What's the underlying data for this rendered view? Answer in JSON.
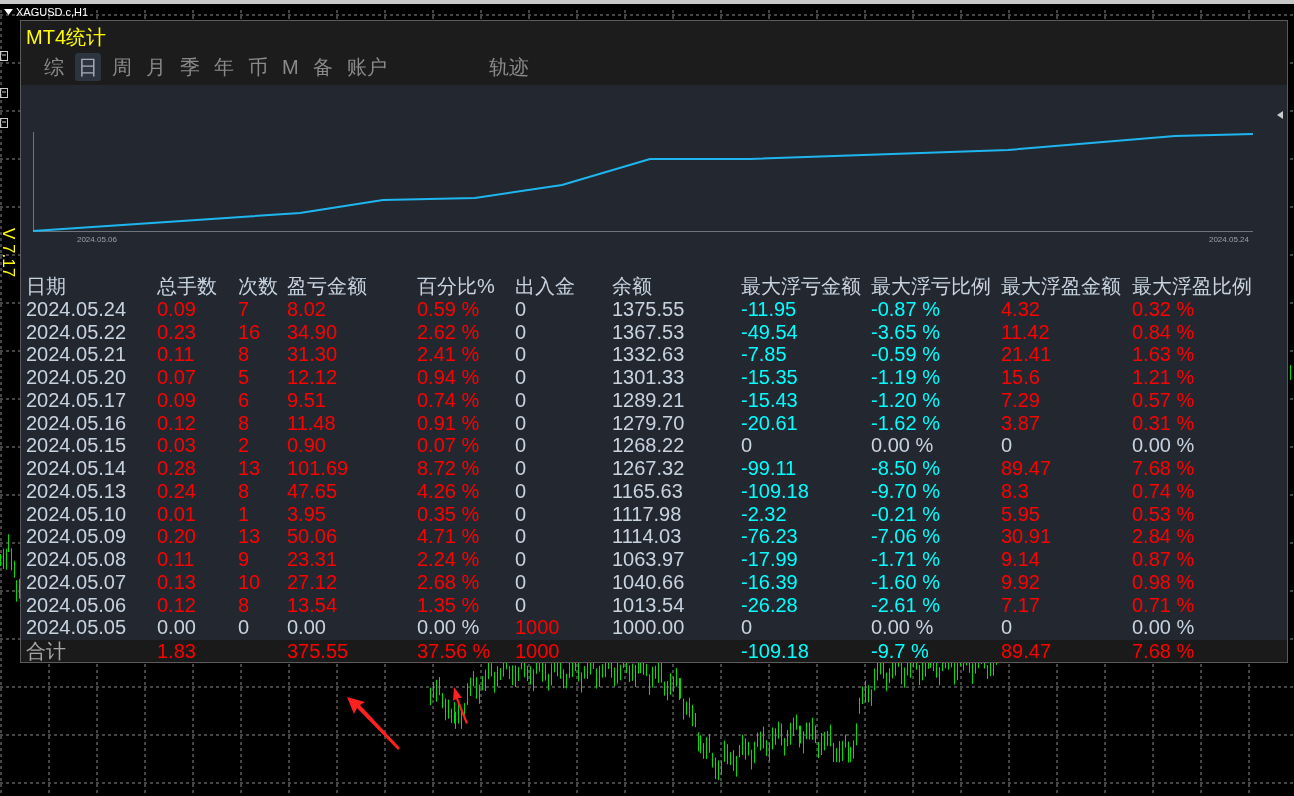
{
  "chart_window": {
    "symbol": "XAGUSD.c,H1",
    "version": "V 7.17"
  },
  "panel": {
    "title": "MT4统计",
    "tabs": [
      {
        "label": "综",
        "selected": false
      },
      {
        "label": "日",
        "selected": true
      },
      {
        "label": "周",
        "selected": false
      },
      {
        "label": "月",
        "selected": false
      },
      {
        "label": "季",
        "selected": false
      },
      {
        "label": "年",
        "selected": false
      },
      {
        "label": "币",
        "selected": false
      },
      {
        "label": "M",
        "selected": false
      },
      {
        "label": "备",
        "selected": false
      },
      {
        "label": "账户",
        "selected": false
      },
      {
        "label": "轨迹",
        "selected": false
      }
    ],
    "equity_chart": {
      "axis_labels": [
        "2024.05.06",
        "2024.05.24"
      ]
    },
    "table": {
      "columns": [
        "日期",
        "总手数",
        "次数",
        "盈亏金额",
        "百分比%",
        "出入金",
        "余额",
        "最大浮亏金额",
        "最大浮亏比例",
        "最大浮盈金额",
        "最大浮盈比例"
      ],
      "rows": [
        [
          {
            "text": "2024.05.24",
            "color": "#c8d3e0"
          },
          {
            "text": "0.09",
            "color": "#ff0000"
          },
          {
            "text": "7",
            "color": "#ff0000"
          },
          {
            "text": "8.02",
            "color": "#ff0000"
          },
          {
            "text": "0.59 %",
            "color": "#ff0000"
          },
          {
            "text": "0",
            "color": "#c8d3e0"
          },
          {
            "text": "1375.55",
            "color": "#c8d3e0"
          },
          {
            "text": "-11.95",
            "color": "#00ffff"
          },
          {
            "text": "-0.87 %",
            "color": "#00ffff"
          },
          {
            "text": "4.32",
            "color": "#ff0000"
          },
          {
            "text": "0.32 %",
            "color": "#ff0000"
          }
        ],
        [
          {
            "text": "2024.05.22",
            "color": "#c8d3e0"
          },
          {
            "text": "0.23",
            "color": "#ff0000"
          },
          {
            "text": "16",
            "color": "#ff0000"
          },
          {
            "text": "34.90",
            "color": "#ff0000"
          },
          {
            "text": "2.62 %",
            "color": "#ff0000"
          },
          {
            "text": "0",
            "color": "#c8d3e0"
          },
          {
            "text": "1367.53",
            "color": "#c8d3e0"
          },
          {
            "text": "-49.54",
            "color": "#00ffff"
          },
          {
            "text": "-3.65 %",
            "color": "#00ffff"
          },
          {
            "text": "11.42",
            "color": "#ff0000"
          },
          {
            "text": "0.84 %",
            "color": "#ff0000"
          }
        ],
        [
          {
            "text": "2024.05.21",
            "color": "#c8d3e0"
          },
          {
            "text": "0.11",
            "color": "#ff0000"
          },
          {
            "text": "8",
            "color": "#ff0000"
          },
          {
            "text": "31.30",
            "color": "#ff0000"
          },
          {
            "text": "2.41 %",
            "color": "#ff0000"
          },
          {
            "text": "0",
            "color": "#c8d3e0"
          },
          {
            "text": "1332.63",
            "color": "#c8d3e0"
          },
          {
            "text": "-7.85",
            "color": "#00ffff"
          },
          {
            "text": "-0.59 %",
            "color": "#00ffff"
          },
          {
            "text": "21.41",
            "color": "#ff0000"
          },
          {
            "text": "1.63 %",
            "color": "#ff0000"
          }
        ],
        [
          {
            "text": "2024.05.20",
            "color": "#c8d3e0"
          },
          {
            "text": "0.07",
            "color": "#ff0000"
          },
          {
            "text": "5",
            "color": "#ff0000"
          },
          {
            "text": "12.12",
            "color": "#ff0000"
          },
          {
            "text": "0.94 %",
            "color": "#ff0000"
          },
          {
            "text": "0",
            "color": "#c8d3e0"
          },
          {
            "text": "1301.33",
            "color": "#c8d3e0"
          },
          {
            "text": "-15.35",
            "color": "#00ffff"
          },
          {
            "text": "-1.19 %",
            "color": "#00ffff"
          },
          {
            "text": "15.6",
            "color": "#ff0000"
          },
          {
            "text": "1.21 %",
            "color": "#ff0000"
          }
        ],
        [
          {
            "text": "2024.05.17",
            "color": "#c8d3e0"
          },
          {
            "text": "0.09",
            "color": "#ff0000"
          },
          {
            "text": "6",
            "color": "#ff0000"
          },
          {
            "text": "9.51",
            "color": "#ff0000"
          },
          {
            "text": "0.74 %",
            "color": "#ff0000"
          },
          {
            "text": "0",
            "color": "#c8d3e0"
          },
          {
            "text": "1289.21",
            "color": "#c8d3e0"
          },
          {
            "text": "-15.43",
            "color": "#00ffff"
          },
          {
            "text": "-1.20 %",
            "color": "#00ffff"
          },
          {
            "text": "7.29",
            "color": "#ff0000"
          },
          {
            "text": "0.57 %",
            "color": "#ff0000"
          }
        ],
        [
          {
            "text": "2024.05.16",
            "color": "#c8d3e0"
          },
          {
            "text": "0.12",
            "color": "#ff0000"
          },
          {
            "text": "8",
            "color": "#ff0000"
          },
          {
            "text": "11.48",
            "color": "#ff0000"
          },
          {
            "text": "0.91 %",
            "color": "#ff0000"
          },
          {
            "text": "0",
            "color": "#c8d3e0"
          },
          {
            "text": "1279.70",
            "color": "#c8d3e0"
          },
          {
            "text": "-20.61",
            "color": "#00ffff"
          },
          {
            "text": "-1.62 %",
            "color": "#00ffff"
          },
          {
            "text": "3.87",
            "color": "#ff0000"
          },
          {
            "text": "0.31 %",
            "color": "#ff0000"
          }
        ],
        [
          {
            "text": "2024.05.15",
            "color": "#c8d3e0"
          },
          {
            "text": "0.03",
            "color": "#ff0000"
          },
          {
            "text": "2",
            "color": "#ff0000"
          },
          {
            "text": "0.90",
            "color": "#ff0000"
          },
          {
            "text": "0.07 %",
            "color": "#ff0000"
          },
          {
            "text": "0",
            "color": "#c8d3e0"
          },
          {
            "text": "1268.22",
            "color": "#c8d3e0"
          },
          {
            "text": "0",
            "color": "#c8d3e0"
          },
          {
            "text": "0.00 %",
            "color": "#c8d3e0"
          },
          {
            "text": "0",
            "color": "#c8d3e0"
          },
          {
            "text": "0.00 %",
            "color": "#c8d3e0"
          }
        ],
        [
          {
            "text": "2024.05.14",
            "color": "#c8d3e0"
          },
          {
            "text": "0.28",
            "color": "#ff0000"
          },
          {
            "text": "13",
            "color": "#ff0000"
          },
          {
            "text": "101.69",
            "color": "#ff0000"
          },
          {
            "text": "8.72 %",
            "color": "#ff0000"
          },
          {
            "text": "0",
            "color": "#c8d3e0"
          },
          {
            "text": "1267.32",
            "color": "#c8d3e0"
          },
          {
            "text": "-99.11",
            "color": "#00ffff"
          },
          {
            "text": "-8.50 %",
            "color": "#00ffff"
          },
          {
            "text": "89.47",
            "color": "#ff0000"
          },
          {
            "text": "7.68 %",
            "color": "#ff0000"
          }
        ],
        [
          {
            "text": "2024.05.13",
            "color": "#c8d3e0"
          },
          {
            "text": "0.24",
            "color": "#ff0000"
          },
          {
            "text": "8",
            "color": "#ff0000"
          },
          {
            "text": "47.65",
            "color": "#ff0000"
          },
          {
            "text": "4.26 %",
            "color": "#ff0000"
          },
          {
            "text": "0",
            "color": "#c8d3e0"
          },
          {
            "text": "1165.63",
            "color": "#c8d3e0"
          },
          {
            "text": "-109.18",
            "color": "#00ffff"
          },
          {
            "text": "-9.70 %",
            "color": "#00ffff"
          },
          {
            "text": "8.3",
            "color": "#ff0000"
          },
          {
            "text": "0.74 %",
            "color": "#ff0000"
          }
        ],
        [
          {
            "text": "2024.05.10",
            "color": "#c8d3e0"
          },
          {
            "text": "0.01",
            "color": "#ff0000"
          },
          {
            "text": "1",
            "color": "#ff0000"
          },
          {
            "text": "3.95",
            "color": "#ff0000"
          },
          {
            "text": "0.35 %",
            "color": "#ff0000"
          },
          {
            "text": "0",
            "color": "#c8d3e0"
          },
          {
            "text": "1117.98",
            "color": "#c8d3e0"
          },
          {
            "text": "-2.32",
            "color": "#00ffff"
          },
          {
            "text": "-0.21 %",
            "color": "#00ffff"
          },
          {
            "text": "5.95",
            "color": "#ff0000"
          },
          {
            "text": "0.53 %",
            "color": "#ff0000"
          }
        ],
        [
          {
            "text": "2024.05.09",
            "color": "#c8d3e0"
          },
          {
            "text": "0.20",
            "color": "#ff0000"
          },
          {
            "text": "13",
            "color": "#ff0000"
          },
          {
            "text": "50.06",
            "color": "#ff0000"
          },
          {
            "text": "4.71 %",
            "color": "#ff0000"
          },
          {
            "text": "0",
            "color": "#c8d3e0"
          },
          {
            "text": "1114.03",
            "color": "#c8d3e0"
          },
          {
            "text": "-76.23",
            "color": "#00ffff"
          },
          {
            "text": "-7.06 %",
            "color": "#00ffff"
          },
          {
            "text": "30.91",
            "color": "#ff0000"
          },
          {
            "text": "2.84 %",
            "color": "#ff0000"
          }
        ],
        [
          {
            "text": "2024.05.08",
            "color": "#c8d3e0"
          },
          {
            "text": "0.11",
            "color": "#ff0000"
          },
          {
            "text": "9",
            "color": "#ff0000"
          },
          {
            "text": "23.31",
            "color": "#ff0000"
          },
          {
            "text": "2.24 %",
            "color": "#ff0000"
          },
          {
            "text": "0",
            "color": "#c8d3e0"
          },
          {
            "text": "1063.97",
            "color": "#c8d3e0"
          },
          {
            "text": "-17.99",
            "color": "#00ffff"
          },
          {
            "text": "-1.71 %",
            "color": "#00ffff"
          },
          {
            "text": "9.14",
            "color": "#ff0000"
          },
          {
            "text": "0.87 %",
            "color": "#ff0000"
          }
        ],
        [
          {
            "text": "2024.05.07",
            "color": "#c8d3e0"
          },
          {
            "text": "0.13",
            "color": "#ff0000"
          },
          {
            "text": "10",
            "color": "#ff0000"
          },
          {
            "text": "27.12",
            "color": "#ff0000"
          },
          {
            "text": "2.68 %",
            "color": "#ff0000"
          },
          {
            "text": "0",
            "color": "#c8d3e0"
          },
          {
            "text": "1040.66",
            "color": "#c8d3e0"
          },
          {
            "text": "-16.39",
            "color": "#00ffff"
          },
          {
            "text": "-1.60 %",
            "color": "#00ffff"
          },
          {
            "text": "9.92",
            "color": "#ff0000"
          },
          {
            "text": "0.98 %",
            "color": "#ff0000"
          }
        ],
        [
          {
            "text": "2024.05.06",
            "color": "#c8d3e0"
          },
          {
            "text": "0.12",
            "color": "#ff0000"
          },
          {
            "text": "8",
            "color": "#ff0000"
          },
          {
            "text": "13.54",
            "color": "#ff0000"
          },
          {
            "text": "1.35 %",
            "color": "#ff0000"
          },
          {
            "text": "0",
            "color": "#c8d3e0"
          },
          {
            "text": "1013.54",
            "color": "#c8d3e0"
          },
          {
            "text": "-26.28",
            "color": "#00ffff"
          },
          {
            "text": "-2.61 %",
            "color": "#00ffff"
          },
          {
            "text": "7.17",
            "color": "#ff0000"
          },
          {
            "text": "0.71 %",
            "color": "#ff0000"
          }
        ],
        [
          {
            "text": "2024.05.05",
            "color": "#c8d3e0"
          },
          {
            "text": "0.00",
            "color": "#c8d3e0"
          },
          {
            "text": "0",
            "color": "#c8d3e0"
          },
          {
            "text": "0.00",
            "color": "#c8d3e0"
          },
          {
            "text": "0.00 %",
            "color": "#c8d3e0"
          },
          {
            "text": "1000",
            "color": "#ff0000"
          },
          {
            "text": "1000.00",
            "color": "#c8d3e0"
          },
          {
            "text": "0",
            "color": "#c8d3e0"
          },
          {
            "text": "0.00 %",
            "color": "#c8d3e0"
          },
          {
            "text": "0",
            "color": "#c8d3e0"
          },
          {
            "text": "0.00 %",
            "color": "#c8d3e0"
          }
        ]
      ],
      "totals": {
        "label": {
          "text": "合计",
          "color": "#a8a8a8"
        },
        "total_lots": {
          "text": "1.83",
          "color": "#ff0000"
        },
        "total_profit": {
          "text": "375.55",
          "color": "#ff0000"
        },
        "total_percent": {
          "text": "37.56 %",
          "color": "#ff0000"
        },
        "total_deposits": {
          "text": "1000",
          "color": "#ff0000"
        },
        "max_floating_loss": {
          "text": "-109.18",
          "color": "#00ffff"
        },
        "max_floating_loss_ratio": {
          "text": "-9.7 %",
          "color": "#00ffff"
        },
        "max_floating_profit": {
          "text": "89.47",
          "color": "#ff0000"
        },
        "max_floating_profit_ratio": {
          "text": "7.68 %",
          "color": "#ff0000"
        }
      }
    }
  }
}
